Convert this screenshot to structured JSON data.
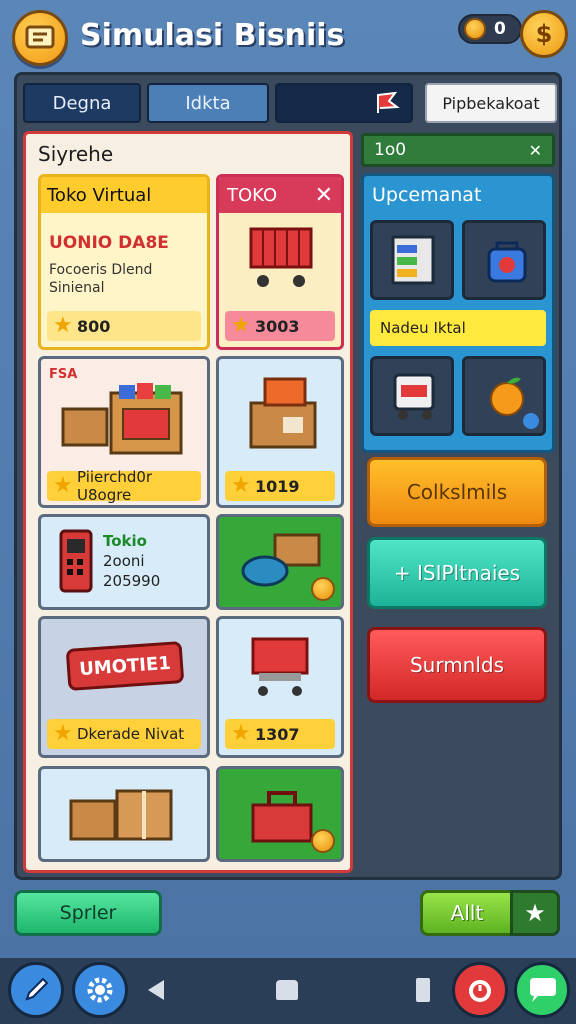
{
  "header": {
    "title": "Simulasi Bisniis",
    "coins": "0",
    "currency_symbol": "$"
  },
  "tabs": [
    {
      "label": "Degna"
    },
    {
      "label": "Idkta"
    },
    {
      "label": ""
    },
    {
      "label": "Pipbekakoat"
    }
  ],
  "store": {
    "title": "Siyrehe",
    "cards": [
      {
        "title": "Toko Virtual",
        "sub_heading": "UONIO DA8E",
        "description": "Focoeris Dlend Sinienal",
        "price": "800"
      },
      {
        "title": "TOKO",
        "price": "3003"
      },
      {
        "tag": "FSA",
        "label": "Piierchd0r U8ogre"
      },
      {
        "price": "1019"
      },
      {
        "line1": "Tokio",
        "line2": "2ooni",
        "line3": "205990"
      },
      {},
      {
        "sign": "UMOTIE1",
        "label": "Dkerade Nivat"
      },
      {
        "price": "1307"
      },
      {},
      {}
    ]
  },
  "side": {
    "header": "1o0",
    "box_title": "Upcemanat",
    "banner": "Nadeu Iktal",
    "btn_orange": "Colkslmils",
    "btn_teal": "+ ISIPltnaies",
    "btn_red": "Surmnlds"
  },
  "bottom": {
    "supplier": "Sprler",
    "all": "Allt"
  },
  "icons": [
    "store-icon",
    "coin-icon",
    "dollar-icon",
    "flag-icon",
    "close-icon",
    "star-icon",
    "edit-icon",
    "gear-icon",
    "back-icon",
    "home-icon",
    "recent-icon",
    "alarm-icon",
    "chat-icon"
  ]
}
